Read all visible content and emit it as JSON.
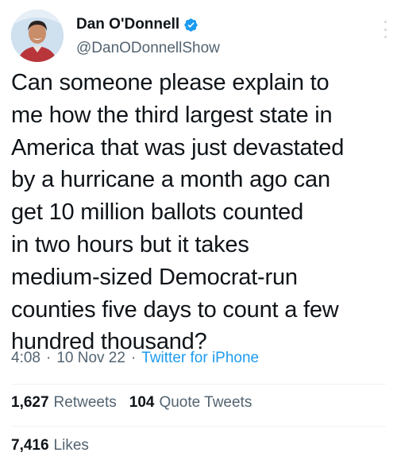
{
  "author": {
    "display_name": "Dan O'Donnell",
    "handle": "@DanODonnellShow",
    "verified_icon": "verified-badge-icon",
    "avatar": "profile-photo"
  },
  "tweet": {
    "text": "Can someone please explain to\nme how the third largest state in\nAmerica that was just devastated\nby a hurricane a month ago can\nget 10 million ballots counted\nin two hours but it takes\nmedium-sized Democrat-run\ncounties five days to count a few\nhundred thousand?",
    "time": "4:08",
    "date": "10 Nov 22",
    "separator": "·",
    "source": "Twitter for iPhone"
  },
  "stats": {
    "retweets_count": "1,627",
    "retweets_label": "Retweets",
    "quote_count": "104",
    "quote_label": "Quote Tweets",
    "likes_count": "7,416",
    "likes_label": "Likes"
  },
  "colors": {
    "text": "#0f1419",
    "secondary": "#536471",
    "accent": "#1d9bf0",
    "divider": "#eff3f4"
  }
}
